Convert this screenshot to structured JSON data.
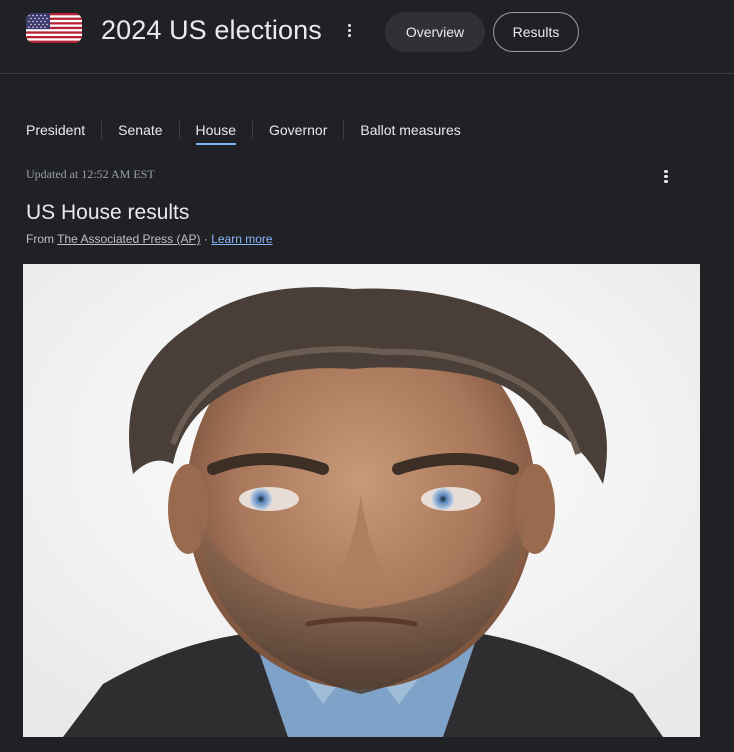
{
  "header": {
    "flag_icon": "us-flag-icon",
    "title": "2024 US elections",
    "menu_icon": "more-vert-icon",
    "overview_label": "Overview",
    "results_label": "Results"
  },
  "tabs": [
    {
      "label": "President",
      "active": false
    },
    {
      "label": "Senate",
      "active": false
    },
    {
      "label": "House",
      "active": true
    },
    {
      "label": "Governor",
      "active": false
    },
    {
      "label": "Ballot measures",
      "active": false
    }
  ],
  "status": {
    "updated": "Updated at 12:52 AM EST"
  },
  "section": {
    "title": "US House results",
    "from_prefix": "From",
    "source_name": "The Associated Press (AP)",
    "separator": "·",
    "learn_more": "Learn more"
  },
  "colors": {
    "background": "#202124",
    "accent": "#8ab4f8",
    "pill_bg": "#303134"
  }
}
